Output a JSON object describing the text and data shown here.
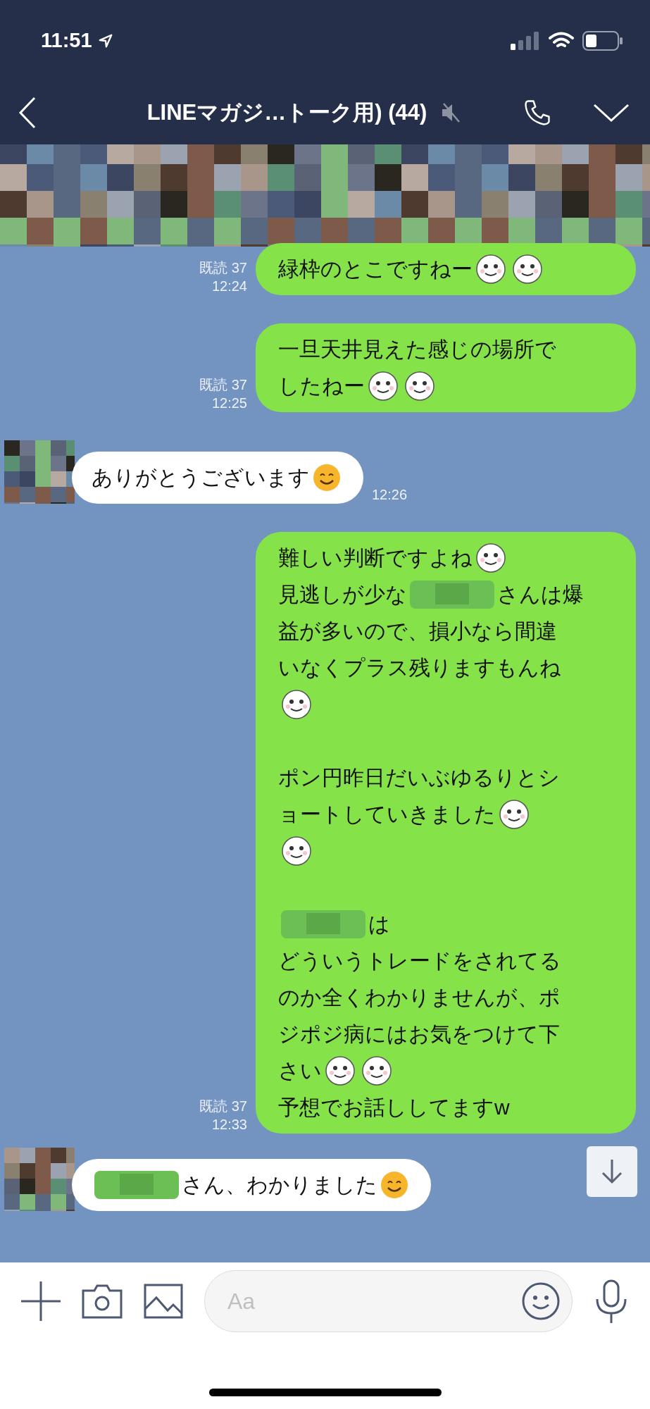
{
  "status_bar": {
    "time": "11:51"
  },
  "header": {
    "title": "LINEマガジ…トーク用) (44)",
    "muted": true
  },
  "messages": [
    {
      "kind": "sent",
      "read": "既読 37",
      "time": "12:24",
      "paragraphs": [
        {
          "lines": [
            {
              "segments": [
                {
                  "kind": "text",
                  "text": "緑枠のとこですねー"
                },
                {
                  "kind": "emoticon"
                },
                {
                  "kind": "emoticon"
                }
              ]
            }
          ]
        }
      ]
    },
    {
      "kind": "sent",
      "read": "既読 37",
      "time": "12:25",
      "paragraphs": [
        {
          "lines": [
            {
              "segments": [
                {
                  "kind": "text",
                  "text": "一旦天井見えた感じの場所で"
                }
              ]
            },
            {
              "segments": [
                {
                  "kind": "text",
                  "text": "したねー"
                },
                {
                  "kind": "emoticon"
                },
                {
                  "kind": "emoticon"
                }
              ]
            }
          ]
        }
      ]
    },
    {
      "kind": "received",
      "time": "12:26",
      "paragraphs": [
        {
          "lines": [
            {
              "segments": [
                {
                  "kind": "text",
                  "text": "ありがとうございます"
                },
                {
                  "kind": "emoji"
                }
              ]
            }
          ]
        }
      ]
    },
    {
      "kind": "sent",
      "read": "既読 37",
      "time": "12:33",
      "paragraphs": [
        {
          "lines": [
            {
              "segments": [
                {
                  "kind": "text",
                  "text": "難しい判断ですよね"
                },
                {
                  "kind": "emoticon"
                }
              ]
            },
            {
              "segments": [
                {
                  "kind": "text",
                  "text": "見逃しが少な"
                },
                {
                  "kind": "mosaic"
                },
                {
                  "kind": "text",
                  "text": "さんは爆"
                }
              ]
            },
            {
              "segments": [
                {
                  "kind": "text",
                  "text": "益が多いので、損小なら間違"
                }
              ]
            },
            {
              "segments": [
                {
                  "kind": "text",
                  "text": "いなくプラス残りますもんね"
                }
              ]
            },
            {
              "segments": [
                {
                  "kind": "emoticon"
                }
              ]
            }
          ]
        },
        {
          "lines": [
            {
              "segments": [
                {
                  "kind": "text",
                  "text": "ポン円昨日だいぶゆるりとシ"
                }
              ]
            },
            {
              "segments": [
                {
                  "kind": "text",
                  "text": "ョートしていきました"
                },
                {
                  "kind": "emoticon"
                }
              ]
            },
            {
              "segments": [
                {
                  "kind": "emoticon"
                }
              ]
            }
          ]
        },
        {
          "lines": [
            {
              "segments": [
                {
                  "kind": "mosaic"
                },
                {
                  "kind": "text",
                  "text": "は"
                }
              ]
            },
            {
              "segments": [
                {
                  "kind": "text",
                  "text": "どういうトレードをされてる"
                }
              ]
            },
            {
              "segments": [
                {
                  "kind": "text",
                  "text": "のか全くわかりませんが、ポ"
                }
              ]
            },
            {
              "segments": [
                {
                  "kind": "text",
                  "text": "ジポジ病にはお気をつけて下"
                }
              ]
            },
            {
              "segments": [
                {
                  "kind": "text",
                  "text": "さい"
                },
                {
                  "kind": "emoticon"
                },
                {
                  "kind": "emoticon"
                }
              ]
            },
            {
              "segments": [
                {
                  "kind": "text",
                  "text": "予想でお話ししてますw"
                }
              ]
            }
          ]
        }
      ]
    },
    {
      "kind": "received",
      "paragraphs": [
        {
          "lines": [
            {
              "segments": [
                {
                  "kind": "mosaic"
                },
                {
                  "kind": "text",
                  "text": "さん、わかりました"
                },
                {
                  "kind": "emoji"
                }
              ]
            }
          ]
        }
      ]
    }
  ],
  "input": {
    "placeholder": "Aa"
  }
}
